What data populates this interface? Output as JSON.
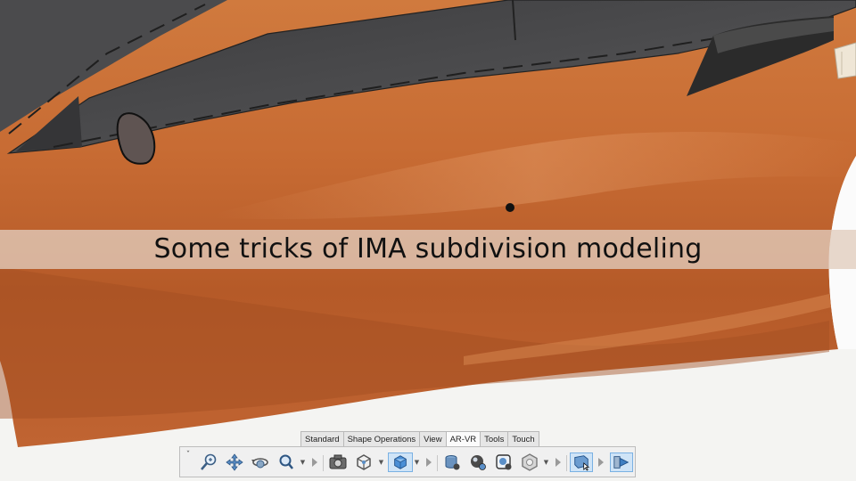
{
  "caption": "Some tricks of IMA subdivision modeling",
  "ribbon_tabs": [
    "Standard",
    "Shape Operations",
    "View",
    "AR-VR",
    "Tools",
    "Touch"
  ],
  "active_tab": "AR-VR",
  "toolbar_icons": [
    "zoom-icon",
    "pan-icon",
    "rotate-icon",
    "zoom-area-icon",
    "screenshot-icon",
    "view-cube-icon",
    "shading-mode-icon",
    "part-settings-icon",
    "material-settings-icon",
    "render-settings-icon",
    "mesh-icon",
    "display-mode-icon",
    "scene-export-icon"
  ],
  "colors": {
    "body_paint": "#c46a34",
    "glass": "#4a4a4c",
    "caption_band": "#e1cdbe",
    "toolbar_bg": "#f0f0f0",
    "selected_icon_bg": "#cfe4f7"
  }
}
